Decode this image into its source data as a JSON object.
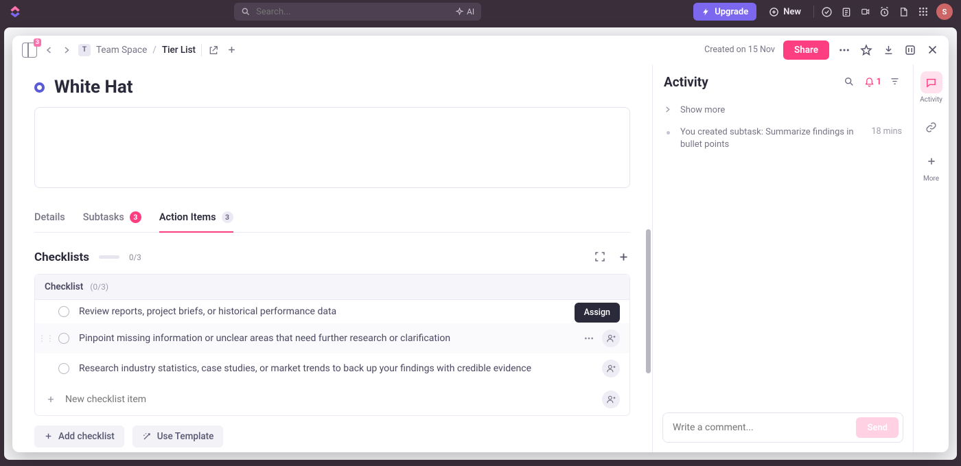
{
  "topbar": {
    "search_placeholder": "Search...",
    "ai_label": "AI",
    "upgrade_label": "Upgrade",
    "new_label": "New",
    "avatar_initial": "S"
  },
  "header": {
    "sidebar_badge": "3",
    "breadcrumb": {
      "space_initial": "T",
      "space": "Team Space",
      "list": "Tier List"
    },
    "created_label": "Created on 15 Nov",
    "share_label": "Share"
  },
  "task": {
    "title": "White Hat",
    "status_color": "#5b5bd6"
  },
  "tabs": {
    "details": "Details",
    "subtasks": "Subtasks",
    "subtasks_count": "3",
    "action_items": "Action Items",
    "action_items_count": "3"
  },
  "checklists": {
    "heading": "Checklists",
    "progress_label": "0/3",
    "group_title": "Checklist",
    "group_count": "(0/3)",
    "items": [
      {
        "text": "Review reports, project briefs, or historical performance data"
      },
      {
        "text": "Pinpoint missing information or unclear areas that need further research or clarification"
      },
      {
        "text": "Research industry statistics, case studies, or market trends to back up your findings with credible evidence"
      }
    ],
    "new_item_placeholder": "New checklist item",
    "add_checklist_label": "Add checklist",
    "use_template_label": "Use Template",
    "assign_tooltip": "Assign"
  },
  "activity": {
    "heading": "Activity",
    "notif_count": "1",
    "show_more": "Show more",
    "entries": [
      {
        "text": "You created subtask: Summarize findings in bullet points",
        "time": "18 mins"
      }
    ],
    "comment_placeholder": "Write a comment...",
    "send_label": "Send"
  },
  "rail": {
    "activity_label": "Activity",
    "more_label": "More"
  }
}
